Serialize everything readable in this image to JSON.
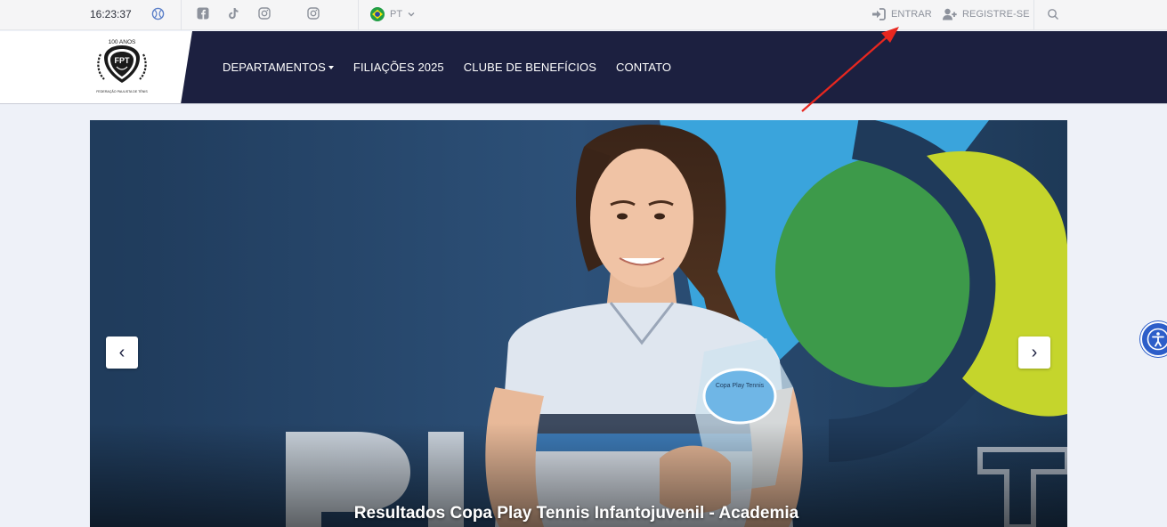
{
  "topbar": {
    "time": "16:23:37",
    "language": "PT",
    "login_label": "ENTRAR",
    "register_label": "REGISTRE-SE",
    "icons": [
      "tennis-ball-icon",
      "facebook-icon",
      "tiktok-icon",
      "instagram-icon",
      "instagram-icon",
      "brazil-flag-icon",
      "chevron-down-icon",
      "login-icon",
      "user-plus-icon",
      "search-icon"
    ]
  },
  "nav": {
    "items": [
      {
        "label": "DEPARTAMENTOS",
        "has_dropdown": true
      },
      {
        "label": "FILIAÇÕES 2025"
      },
      {
        "label": "CLUBE DE BENEFÍCIOS"
      },
      {
        "label": "CONTATO"
      }
    ]
  },
  "logo": {
    "top_text": "100 ANOS",
    "bottom_text": "FEDERAÇÃO PAULISTA DE TÊNIS",
    "monogram": "FPT"
  },
  "carousel": {
    "title": "Resultados Copa Play Tennis Infantojuvenil - Academia",
    "prev_label": "‹",
    "next_label": "›"
  },
  "colors": {
    "nav_bg": "#1c2040",
    "topbar_bg": "#f5f5f6",
    "page_bg": "#eef1f8",
    "accent_blue": "#2d5ec9",
    "annotation_red": "#e8271f"
  }
}
